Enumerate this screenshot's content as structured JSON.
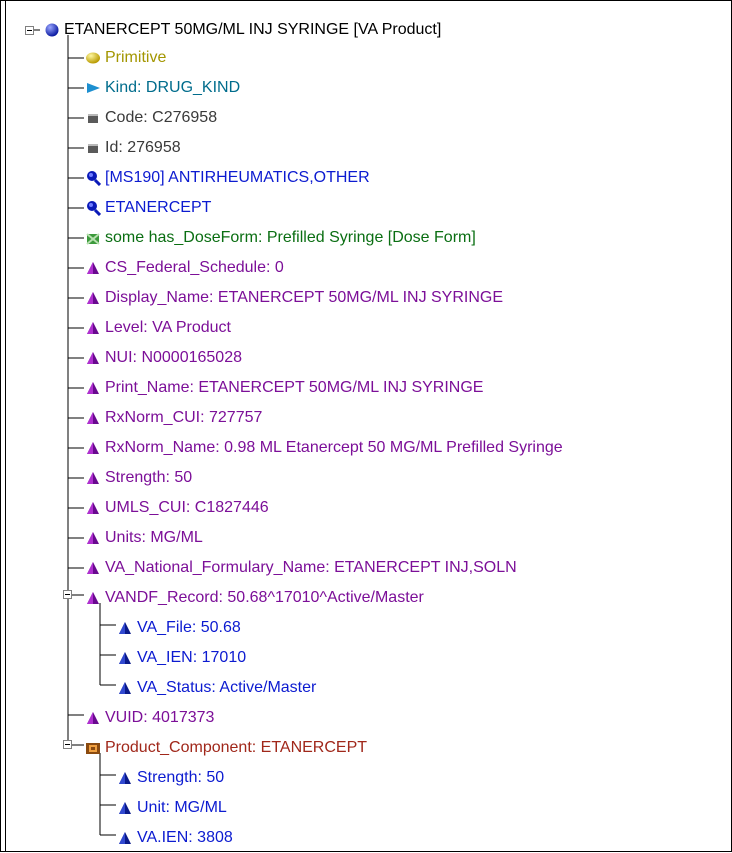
{
  "root": {
    "label": "ETANERCEPT 50MG/ML INJ SYRINGE [VA Product]",
    "icon": "concept-ball-icon"
  },
  "children": [
    {
      "label": "Primitive",
      "icon": "primitive-ball-icon"
    },
    {
      "label": "Kind:  DRUG_KIND",
      "icon": "kind-arrow-icon"
    },
    {
      "label": "Code:  C276958",
      "icon": "code-block-icon"
    },
    {
      "label": "Id:  276958",
      "icon": "id-block-icon"
    },
    {
      "label": "[MS190] ANTIRHEUMATICS,OTHER",
      "icon": "superconcept-magnifier-icon"
    },
    {
      "label": "ETANERCEPT",
      "icon": "superconcept-magnifier-icon"
    },
    {
      "label": "some has_DoseForm: Prefilled Syringe [Dose Form]",
      "icon": "role-restriction-icon"
    },
    {
      "label": "CS_Federal_Schedule: 0",
      "icon": "property-triangle-icon"
    },
    {
      "label": "Display_Name: ETANERCEPT 50MG/ML INJ SYRINGE",
      "icon": "property-triangle-icon"
    },
    {
      "label": "Level: VA Product",
      "icon": "property-triangle-icon"
    },
    {
      "label": "NUI: N0000165028",
      "icon": "property-triangle-icon"
    },
    {
      "label": "Print_Name: ETANERCEPT 50MG/ML INJ SYRINGE",
      "icon": "property-triangle-icon"
    },
    {
      "label": "RxNorm_CUI: 727757",
      "icon": "property-triangle-icon"
    },
    {
      "label": "RxNorm_Name: 0.98 ML Etanercept 50 MG/ML Prefilled Syringe",
      "icon": "property-triangle-icon"
    },
    {
      "label": "Strength: 50",
      "icon": "property-triangle-icon"
    },
    {
      "label": "UMLS_CUI: C1827446",
      "icon": "property-triangle-icon"
    },
    {
      "label": "Units: MG/ML",
      "icon": "property-triangle-icon"
    },
    {
      "label": "VA_National_Formulary_Name: ETANERCEPT INJ,SOLN",
      "icon": "property-triangle-icon"
    },
    {
      "label": "VANDF_Record: 50.68^17010^Active/Master",
      "icon": "property-triangle-icon",
      "expanded": true,
      "children": [
        {
          "label": "VA_File: 50.68",
          "icon": "qualifier-triangle-icon"
        },
        {
          "label": "VA_IEN: 17010",
          "icon": "qualifier-triangle-icon"
        },
        {
          "label": "VA_Status: Active/Master",
          "icon": "qualifier-triangle-icon"
        }
      ]
    },
    {
      "label": "VUID: 4017373",
      "icon": "property-triangle-icon"
    },
    {
      "label": "Product_Component: ETANERCEPT",
      "icon": "component-box-icon",
      "expanded": true,
      "children": [
        {
          "label": "Strength: 50",
          "icon": "qualifier-triangle-icon"
        },
        {
          "label": "Unit: MG/ML",
          "icon": "qualifier-triangle-icon"
        },
        {
          "label": "VA.IEN: 3808",
          "icon": "qualifier-triangle-icon"
        }
      ]
    }
  ],
  "colors": {
    "root": "#000000",
    "primitive": "#a39600",
    "kind": "#006c8c",
    "code": "#3a3a3a",
    "superconcept": "#0c1bd0",
    "role": "#0a6e12",
    "property": "#7c0f98",
    "qualifier": "#0c1bd0",
    "component": "#a0271a"
  }
}
